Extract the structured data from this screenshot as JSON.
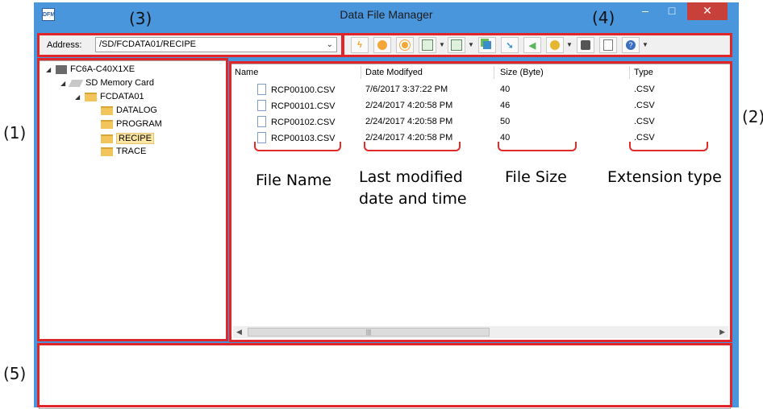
{
  "callouts": {
    "c1": "(1)",
    "c2": "(2)",
    "c3": "(3)",
    "c4": "(4)",
    "c5": "(5)"
  },
  "window": {
    "title": "Data File Manager",
    "app_icon": "DFM",
    "controls": {
      "minimize": "–",
      "maximize": "□",
      "close": "✕"
    }
  },
  "address": {
    "label": "Address:",
    "value": "/SD/FCDATA01/RECIPE"
  },
  "toolbar": {
    "buttons": [
      "connect-icon",
      "start-icon",
      "stop-icon",
      "download-icon",
      "upload-icon",
      "copy-icon",
      "move-icon",
      "back-icon",
      "memory-icon",
      "save-icon",
      "new-file-icon",
      "help-icon"
    ]
  },
  "tree": {
    "nodes": [
      {
        "label": "FC6A-C40X1XE",
        "icon": "plc-icon",
        "expanded": true
      },
      {
        "label": "SD Memory Card",
        "icon": "sd-card-icon",
        "expanded": true
      },
      {
        "label": "FCDATA01",
        "icon": "folder-open-icon",
        "expanded": true
      },
      {
        "label": "DATALOG",
        "icon": "folder-icon"
      },
      {
        "label": "PROGRAM",
        "icon": "folder-icon"
      },
      {
        "label": "RECIPE",
        "icon": "folder-icon",
        "selected": true
      },
      {
        "label": "TRACE",
        "icon": "folder-icon"
      }
    ]
  },
  "list": {
    "columns": [
      "Name",
      "Date Modifyed",
      "Size  (Byte)",
      "Type"
    ],
    "rows": [
      {
        "name": "RCP00100.CSV",
        "date": "7/6/2017 3:37:22 PM",
        "size": "40",
        "type": ".CSV"
      },
      {
        "name": "RCP00101.CSV",
        "date": "2/24/2017 4:20:58 PM",
        "size": "46",
        "type": ".CSV"
      },
      {
        "name": "RCP00102.CSV",
        "date": "2/24/2017 4:20:58 PM",
        "size": "50",
        "type": ".CSV"
      },
      {
        "name": "RCP00103.CSV",
        "date": "2/24/2017 4:20:58 PM",
        "size": "40",
        "type": ".CSV"
      }
    ]
  },
  "annotations": {
    "file_name": "File Name",
    "last_modified_1": "Last modified",
    "last_modified_2": "date and time",
    "file_size": "File Size",
    "extension_type": "Extension type"
  },
  "colors": {
    "window_frame": "#4a96dd",
    "highlight_box": "#e0262a",
    "close_button": "#c7403a",
    "selected_folder": "#fce6a2"
  }
}
